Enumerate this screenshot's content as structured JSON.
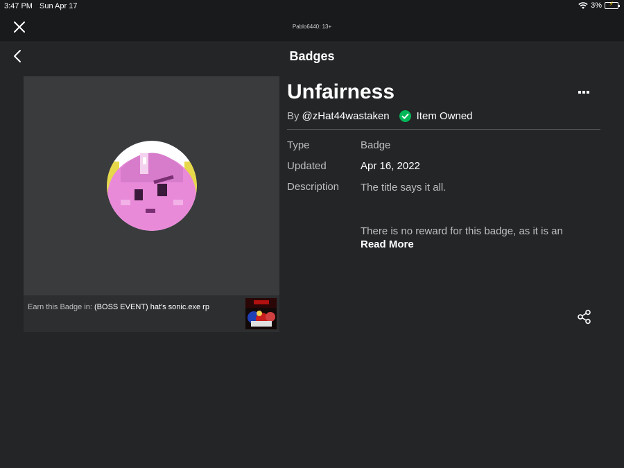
{
  "status_bar": {
    "time": "3:47 PM",
    "date": "Sun Apr 17",
    "battery": "3%",
    "icons": [
      "wifi-icon",
      "battery-icon"
    ]
  },
  "top_bar": {
    "account_label": "Pablo6440: 13+",
    "close_icon": "close-icon"
  },
  "header": {
    "back_icon": "chevron-left-icon",
    "title": "Badges"
  },
  "badge": {
    "name": "Unfairness",
    "by_prefix": "By",
    "creator": "@zHat44wastaken",
    "owned_label": "Item Owned",
    "more_icon": "more-icon",
    "share_icon": "share-icon",
    "details": {
      "type_label": "Type",
      "type_value": "Badge",
      "updated_label": "Updated",
      "updated_value": "Apr 16, 2022",
      "description_label": "Description",
      "description_line1": "The title says it all.",
      "description_line2": "There is no reward for this badge, as it is an",
      "read_more": "Read More"
    },
    "earn_prefix": "Earn this Badge in:",
    "game_name": "(BOSS EVENT) hat's sonic.exe rp"
  },
  "colors": {
    "background": "#232527",
    "card": "#393b3d",
    "owned_green": "#02b757"
  }
}
